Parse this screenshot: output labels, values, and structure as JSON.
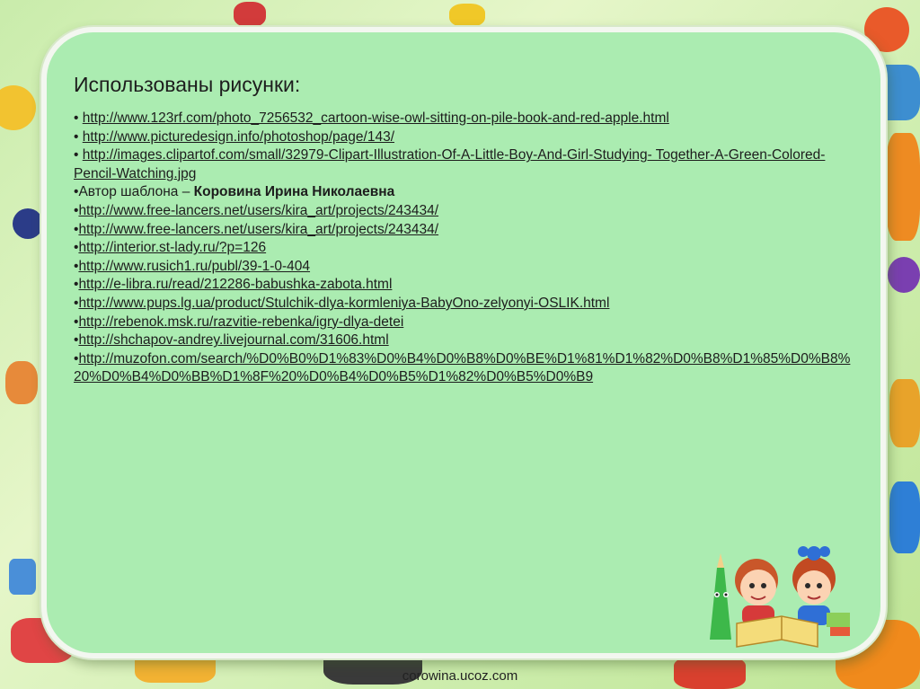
{
  "slide": {
    "heading": "Использованы рисунки:",
    "items": [
      {
        "bullet": "• ",
        "link": "http://www.123rf.com/photo_7256532_cartoon-wise-owl-sitting-on-pile-book-and-red-apple.html"
      },
      {
        "bullet": "• ",
        "link": "http://www.picturedesign.info/photoshop/page/143/"
      },
      {
        "bullet": "• ",
        "link": "http://images.clipartof.com/small/32979-Clipart-Illustration-Of-A-Little-Boy-And-Girl-Studying- Together-A-Green-Colored-Pencil-Watching.jpg"
      },
      {
        "bullet": "•",
        "text": "Автор шаблона – ",
        "bold": "Коровина Ирина Николаевна"
      },
      {
        "bullet": "•",
        "link": "http://www.free-lancers.net/users/kira_art/projects/243434/"
      },
      {
        "bullet": "•",
        "link": "http://www.free-lancers.net/users/kira_art/projects/243434/"
      },
      {
        "bullet": "•",
        "link": "http://interior.st-lady.ru/?p=126"
      },
      {
        "bullet": "•",
        "link": "http://www.rusich1.ru/publ/39-1-0-404"
      },
      {
        "bullet": "•",
        "link": "http://e-libra.ru/read/212286-babushka-zabota.html"
      },
      {
        "bullet": "•",
        "link": "http://www.pups.lg.ua/product/Stulchik-dlya-kormleniya-BabyOno-zelyonyi-OSLIK.html"
      },
      {
        "bullet": "•",
        "link": "http://rebenok.msk.ru/razvitie-rebenka/igry-dlya-detei"
      },
      {
        "bullet": "•",
        "link": "http://shchapov-andrey.livejournal.com/31606.html"
      },
      {
        "bullet": "•",
        "link": "http://muzofon.com/search/%D0%B0%D1%83%D0%B4%D0%B8%D0%BE%D1%81%D1%82%D0%B8%D1%85%D0%B8%20%D0%B4%D0%BB%D1%8F%20%D0%B4%D0%B5%D1%82%D0%B5%D0%B9"
      }
    ]
  },
  "footer": {
    "site": "corowina.ucoz.com"
  },
  "colors": {
    "frame_fill": "#abecb1",
    "frame_border": "#f3f7f0",
    "background": "#cfeeb0"
  },
  "decor": {
    "illustration": "two-kids-with-pencil-and-book"
  }
}
